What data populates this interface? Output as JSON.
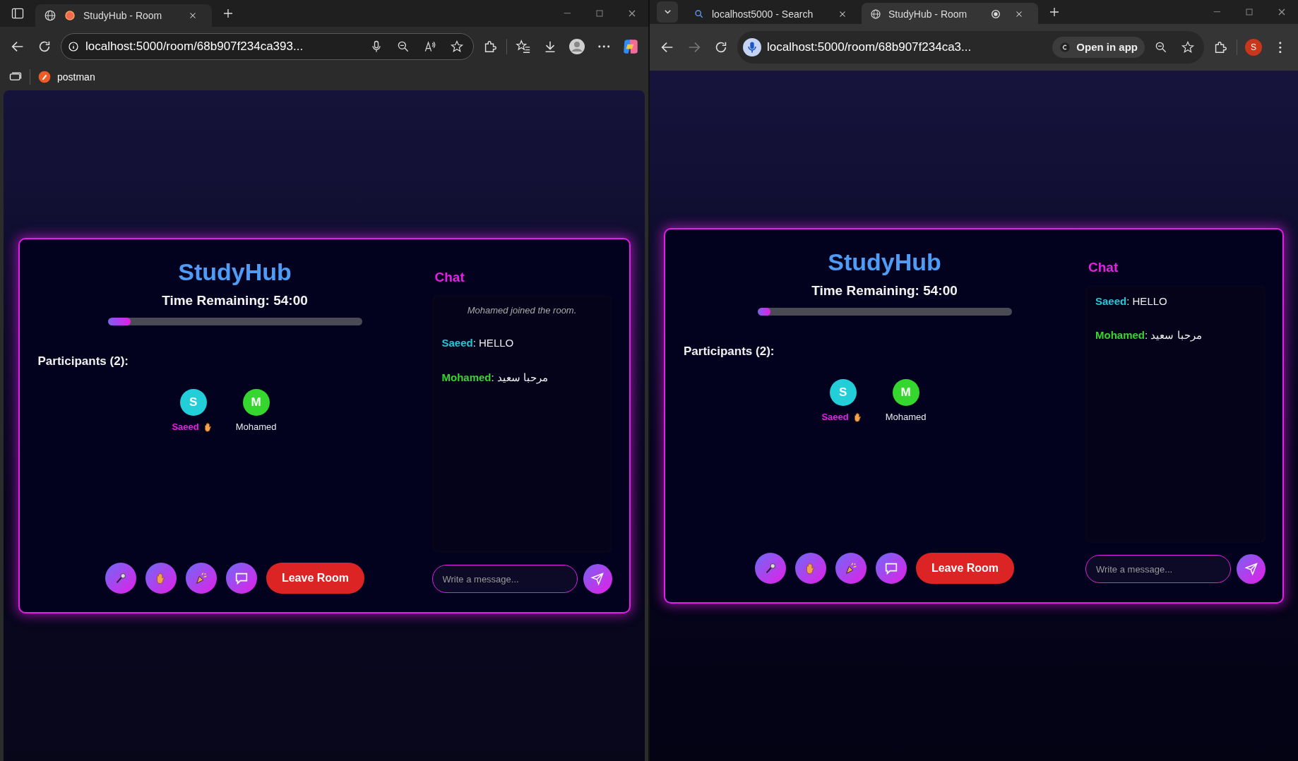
{
  "windows": [
    {
      "kind": "edge",
      "tabs": [
        {
          "label": "StudyHub - Room",
          "selected": true
        }
      ],
      "address": "localhost:5000/room/68b907f234ca393...",
      "bookmarks": [
        "postman"
      ],
      "room": {
        "title": "StudyHub",
        "timer": "Time Remaining: 54:00",
        "progress": {
          "level": 0.09
        },
        "participants_heading": "Participants (2):",
        "participants": [
          {
            "initial": "S",
            "name": "Saeed",
            "color": "#22cfd9",
            "highlighted": true,
            "hand_raised": true
          },
          {
            "initial": "M",
            "name": "Mohamed",
            "color": "#35d62e",
            "highlighted": false,
            "hand_raised": false
          }
        ],
        "leave_button": "Leave Room",
        "chat_title": "Chat",
        "messages": [
          {
            "kind": "system",
            "text": "Mohamed joined the room."
          },
          {
            "kind": "message",
            "sender": "Saeed",
            "color": "#22c8d8",
            "text": ": HELLO"
          },
          {
            "kind": "message",
            "sender": "Mohamed",
            "color": "#36d62c",
            "text": ": مرحبا سعيد"
          }
        ],
        "chat_input": {
          "placeholder": "Write a message..."
        }
      }
    },
    {
      "kind": "chrome",
      "tabs": [
        {
          "label": "localhost5000 - Search",
          "selected": false
        },
        {
          "label": "StudyHub - Room",
          "selected": true
        }
      ],
      "address": "localhost:5000/room/68b907f234ca3...",
      "open_in_app": "Open in app",
      "profile_initial": "S",
      "forward_disabled": true,
      "room": {
        "title": "StudyHub",
        "timer": "Time Remaining: 54:00",
        "progress": {
          "level": 0.05
        },
        "participants_heading": "Participants (2):",
        "participants": [
          {
            "initial": "S",
            "name": "Saeed",
            "color": "#22cfd9",
            "highlighted": true,
            "hand_raised": true
          },
          {
            "initial": "M",
            "name": "Mohamed",
            "color": "#35d62e",
            "highlighted": false,
            "hand_raised": false
          }
        ],
        "leave_button": "Leave Room",
        "chat_title": "Chat",
        "messages": [
          {
            "kind": "message",
            "sender": "Saeed",
            "color": "#22c8d8",
            "text": ": HELLO"
          },
          {
            "kind": "message",
            "sender": "Mohamed",
            "color": "#36d62c",
            "text": ": مرحبا سعيد"
          }
        ],
        "chat_input": {
          "placeholder": "Write a message..."
        }
      }
    }
  ]
}
